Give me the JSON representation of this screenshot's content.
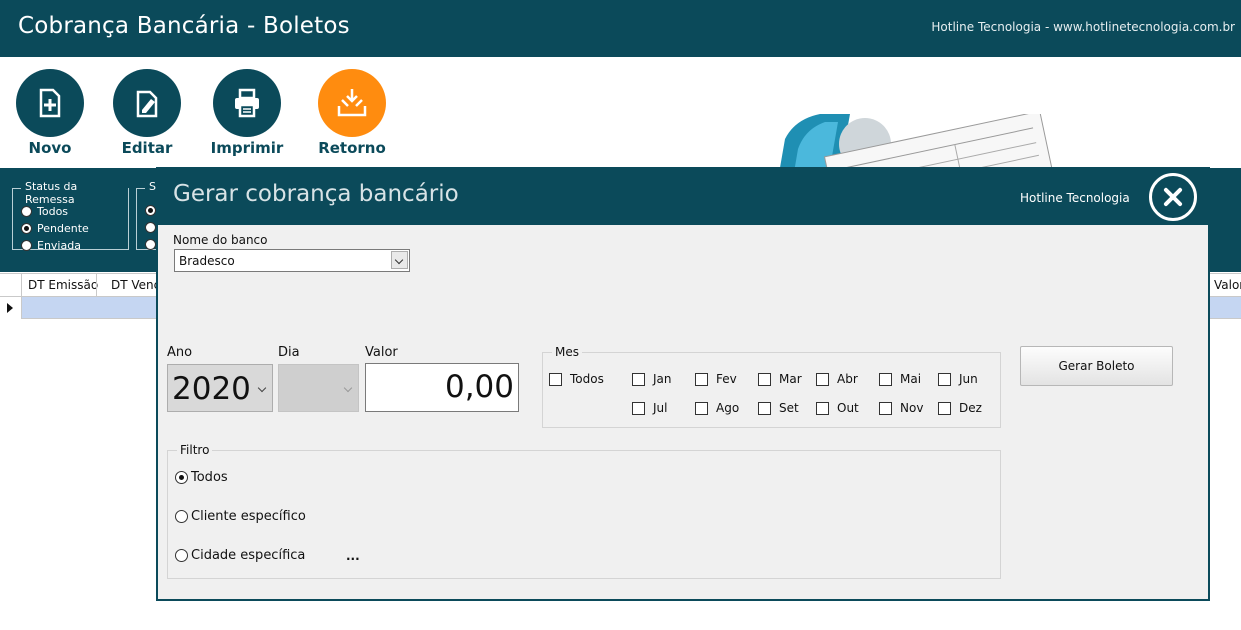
{
  "app": {
    "title": "Cobrança Bancária - Boletos",
    "credit": "Hotline Tecnologia - www.hotlinetecnologia.com.br"
  },
  "toolbar": {
    "buttons": [
      {
        "label": "Novo",
        "icon": "new-document-icon"
      },
      {
        "label": "Editar",
        "icon": "edit-document-icon"
      },
      {
        "label": "Imprimir",
        "icon": "printer-icon"
      },
      {
        "label": "Retorno",
        "icon": "download-tray-icon"
      }
    ]
  },
  "filters": {
    "status_remessa": {
      "title": "Status da Remessa",
      "options": [
        "Todos",
        "Pendente",
        "Enviada"
      ],
      "selected": "Pendente"
    },
    "second_group_title": "Si"
  },
  "grid": {
    "columns": [
      "DT Emissão",
      "DT Venc",
      "Valor"
    ]
  },
  "dialog": {
    "title": "Gerar cobrança bancário",
    "credit": "Hotline Tecnologia",
    "banco": {
      "label": "Nome do banco",
      "value": "Bradesco"
    },
    "ano": {
      "label": "Ano",
      "value": "2020"
    },
    "dia": {
      "label": "Dia",
      "value": ""
    },
    "valor": {
      "label": "Valor",
      "value": "0,00"
    },
    "mes": {
      "title": "Mes",
      "todos": "Todos",
      "row1": [
        "Jan",
        "Fev",
        "Mar",
        "Abr",
        "Mai",
        "Jun"
      ],
      "row2": [
        "Jul",
        "Ago",
        "Set",
        "Out",
        "Nov",
        "Dez"
      ]
    },
    "gerar_label": "Gerar Boleto",
    "filtro": {
      "title": "Filtro",
      "options": [
        "Todos",
        "Cliente específico",
        "Cidade específica"
      ],
      "selected": "Todos",
      "ellipsis": "..."
    }
  },
  "colors": {
    "primary": "#0b4a5a",
    "accent": "#ff8c0f",
    "selection": "#c5d6f2",
    "dialog_bg": "#f0f0f0"
  }
}
